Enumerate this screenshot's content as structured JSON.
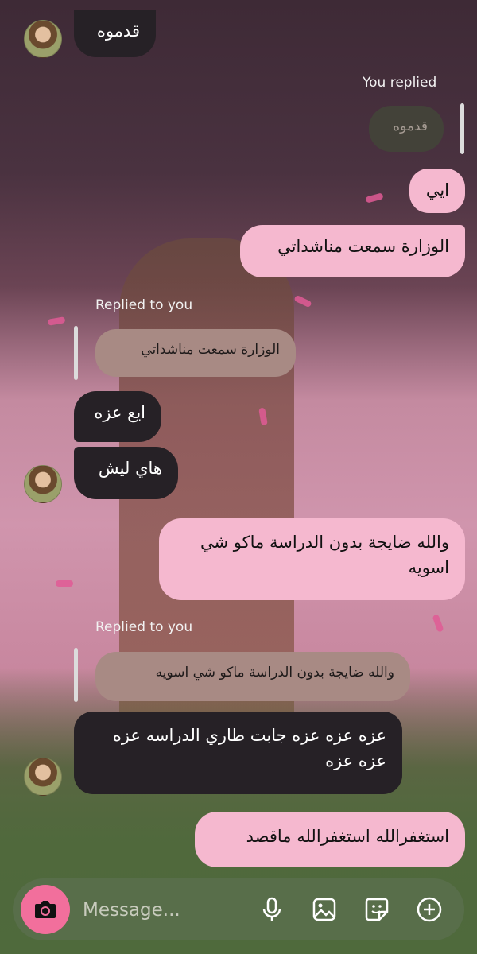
{
  "messages": {
    "m1": "قدموه",
    "you_replied_label": "You replied",
    "m2_quote": "قدموه",
    "m3": "ايي",
    "m4": "الوزارة سمعت مناشداتي",
    "replied_to_you_1": "Replied to you",
    "m5_quote": "الوزارة سمعت مناشداتي",
    "m6": "ايع عزه",
    "m7": "هاي ليش",
    "m8": "والله ضايجة بدون الدراسة ماكو شي اسويه",
    "replied_to_you_2": "Replied to you",
    "m9_quote": "والله ضايجة بدون الدراسة ماكو شي اسويه",
    "m10": "عزه عزه عزه جابت طاري الدراسه عزه عزه عزه",
    "m11": "استغفرالله استغفرالله ماقصد"
  },
  "composer": {
    "placeholder": "Message...",
    "icons": [
      "camera-icon",
      "microphone-icon",
      "gallery-icon",
      "sticker-icon",
      "plus-icon"
    ]
  },
  "colors": {
    "incoming_bubble": "#262126",
    "outgoing_bubble": "#f5b8cf",
    "camera_button": "#f26f9c"
  }
}
